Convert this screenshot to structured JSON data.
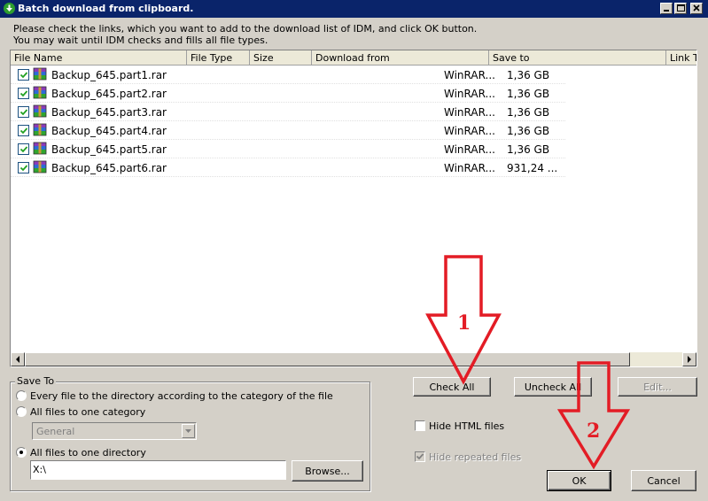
{
  "window": {
    "title": "Batch download from clipboard.",
    "controls": [
      "minimize",
      "maximize",
      "close"
    ]
  },
  "instructions": {
    "line1": "Please check the links, which you want to add to the download list of IDM, and click OK button.",
    "line2": "You may wait until IDM checks and fills all file types."
  },
  "table": {
    "columns": [
      "File Name",
      "File Type",
      "Size",
      "Download from",
      "Save to",
      "Link Te"
    ],
    "rows": [
      {
        "checked": true,
        "name": "Backup_645.part1.rar",
        "save_to": "WinRAR...",
        "size": "1,36  GB"
      },
      {
        "checked": true,
        "name": "Backup_645.part2.rar",
        "save_to": "WinRAR...",
        "size": "1,36  GB"
      },
      {
        "checked": true,
        "name": "Backup_645.part3.rar",
        "save_to": "WinRAR...",
        "size": "1,36  GB"
      },
      {
        "checked": true,
        "name": "Backup_645.part4.rar",
        "save_to": "WinRAR...",
        "size": "1,36  GB"
      },
      {
        "checked": true,
        "name": "Backup_645.part5.rar",
        "save_to": "WinRAR...",
        "size": "1,36  GB"
      },
      {
        "checked": true,
        "name": "Backup_645.part6.rar",
        "save_to": "WinRAR...",
        "size": "931,24 ..."
      }
    ]
  },
  "save_to": {
    "legend": "Save To",
    "option_category_dir": "Every file to the directory according to the category of the file",
    "option_one_category": "All files to one category",
    "category_value": "General",
    "option_one_dir": "All files to one directory",
    "selected": "option_one_dir",
    "directory_value": "X:\\",
    "browse_label": "Browse..."
  },
  "buttons": {
    "check_all": "Check All",
    "uncheck_all": "Uncheck All",
    "edit": "Edit...",
    "ok": "OK",
    "cancel": "Cancel"
  },
  "options": {
    "hide_html": "Hide HTML files",
    "hide_html_checked": false,
    "hide_repeated": "Hide repeated files",
    "hide_repeated_checked": true,
    "hide_repeated_disabled": true
  },
  "annotations": {
    "step1": "1",
    "step2": "2",
    "arrow_color": "#e31c25"
  }
}
